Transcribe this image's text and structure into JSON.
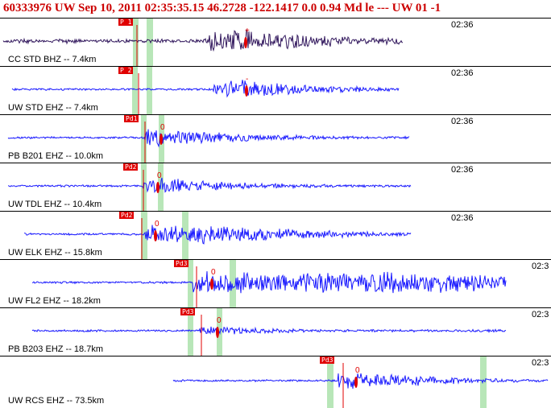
{
  "header": {
    "title": "60333976 UW Sep 10, 2011 02:35:35.15    46.2728 -122.1417  0.0 0.94 Md le --- UW 01   -1"
  },
  "colors": {
    "trace": "#1a1aff",
    "trace_first": "#33195e",
    "pick": "#e00000",
    "window": "#b8e6b8"
  },
  "traces": [
    {
      "label": "CC STD BHZ -- 7.4km",
      "time": "02:36",
      "pick_tag": "P 1",
      "marker": "+"
    },
    {
      "label": "UW STD EHZ -- 7.4km",
      "time": "02:36",
      "pick_tag": "P 2",
      "marker": "-"
    },
    {
      "label": "PB B201 EHZ -- 10.0km",
      "time": "02:36",
      "pick_tag": "Pd1",
      "marker": "0"
    },
    {
      "label": "UW TDL EHZ -- 10.4km",
      "time": "02:36",
      "pick_tag": "Pd2",
      "marker": "0"
    },
    {
      "label": "UW ELK EHZ -- 15.8km",
      "time": "02:36",
      "pick_tag": "Pd2",
      "marker": "0"
    },
    {
      "label": "UW FL2 EHZ -- 18.2km",
      "time": "02:3",
      "pick_tag": "Pd3",
      "marker": "0"
    },
    {
      "label": "PB B203 EHZ -- 18.7km",
      "time": "02:3",
      "pick_tag": "Pd3",
      "marker": "0"
    },
    {
      "label": "UW RCS EHZ -- 73.5km",
      "time": "02:3",
      "pick_tag": "Pd3",
      "marker": "0"
    }
  ]
}
